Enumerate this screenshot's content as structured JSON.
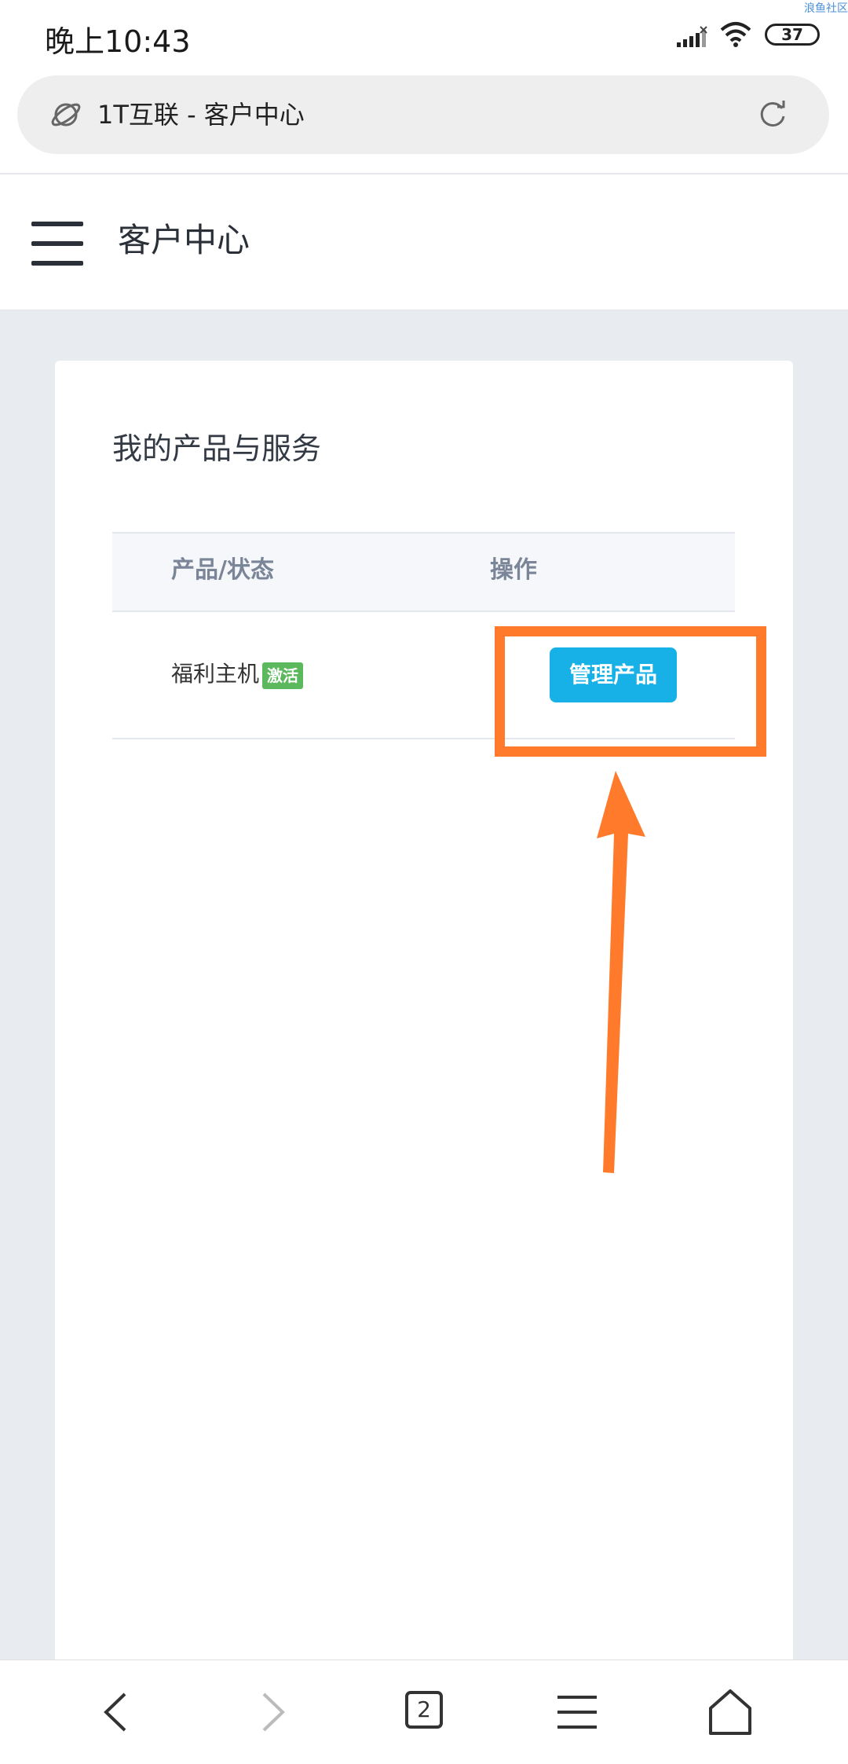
{
  "status_bar": {
    "time": "晚上10:43",
    "battery": "37",
    "watermark": "浪鱼社区"
  },
  "browser": {
    "url_title": "1T互联 - 客户中心",
    "tab_count": "2"
  },
  "header": {
    "title": "客户中心"
  },
  "card": {
    "title": "我的产品与服务",
    "table": {
      "columns": [
        "产品/状态",
        "操作"
      ],
      "rows": [
        {
          "product": "福利主机",
          "status": "激活",
          "action": "管理产品"
        }
      ]
    }
  },
  "colors": {
    "accent_button": "#17b1e8",
    "status_active": "#5cb85c",
    "annotation": "#ff7a2b"
  },
  "icons": {
    "browser": "planet-icon",
    "reload": "reload-icon",
    "menu": "hamburger-icon",
    "nav": [
      "back-icon",
      "forward-icon",
      "tabs-icon",
      "menu-icon",
      "home-icon"
    ]
  }
}
